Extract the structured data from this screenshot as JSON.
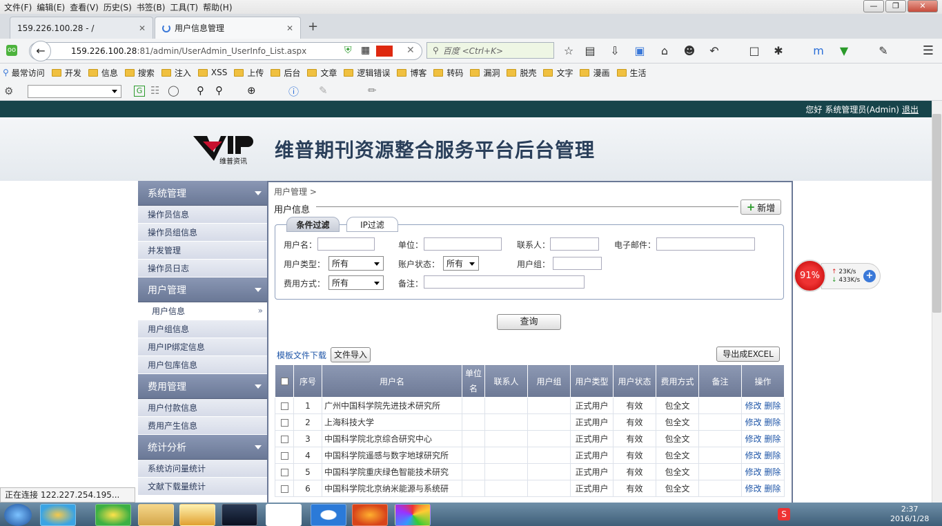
{
  "menubar": {
    "items": [
      "文件(F)",
      "编辑(E)",
      "查看(V)",
      "历史(S)",
      "书签(B)",
      "工具(T)",
      "帮助(H)"
    ]
  },
  "tabs": [
    {
      "label": "159.226.100.28 - /"
    },
    {
      "label": "用户信息管理"
    }
  ],
  "address": {
    "host": "159.226.100.28",
    "rest": ":81/admin/UserAdmin_UserInfo_List.aspx"
  },
  "search": {
    "placeholder": "百度 <Ctrl+K>"
  },
  "bookmarks": [
    "最常访问",
    "开发",
    "信息",
    "搜索",
    "注入",
    "XSS",
    "上传",
    "后台",
    "文章",
    "逻辑错误",
    "博客",
    "转码",
    "漏洞",
    "脱壳",
    "文字",
    "漫画",
    "生活"
  ],
  "header": {
    "greeting": "您好",
    "user": "系统管理员(Admin)",
    "logout": "退出"
  },
  "site": {
    "logo_text": "VIP",
    "logo_sub": "维普资讯",
    "title": "维普期刊资源整合服务平台后台管理"
  },
  "sidebar": {
    "sections": [
      {
        "title": "系统管理",
        "items": [
          "操作员信息",
          "操作员组信息",
          "并发管理",
          "操作员日志"
        ]
      },
      {
        "title": "用户管理",
        "items": [
          "用户信息",
          "用户组信息",
          "用户IP绑定信息",
          "用户包库信息"
        ]
      },
      {
        "title": "费用管理",
        "items": [
          "用户付款信息",
          "费用产生信息"
        ]
      },
      {
        "title": "统计分析",
        "items": [
          "系统访问量统计",
          "文献下载量统计"
        ]
      }
    ],
    "active_item": "用户信息"
  },
  "main": {
    "breadcrumb": "用户管理 >",
    "section_title": "用户信息",
    "add_label": "新增",
    "filter_tabs": [
      "条件过滤",
      "IP过滤"
    ],
    "filters": {
      "username": "用户名：",
      "unit": "单位：",
      "contact": "联系人：",
      "email": "电子邮件：",
      "user_type": "用户类型：",
      "user_type_value": "所有",
      "account_status": "账户状态：",
      "account_status_value": "所有",
      "user_group": "用户组：",
      "fee_mode": "费用方式：",
      "fee_mode_value": "所有",
      "remark": "备注："
    },
    "query_label": "查询",
    "template_link": "模板文件下载",
    "import_label": "文件导入",
    "export_label": "导出成EXCEL",
    "table": {
      "headers": [
        "序号",
        "用户名",
        "单位名",
        "联系人",
        "用户组",
        "用户类型",
        "用户状态",
        "费用方式",
        "备注",
        "操作"
      ],
      "edit_label": "修改",
      "delete_label": "删除",
      "rows": [
        {
          "no": "1",
          "name": "广州中国科学院先进技术研究所",
          "type": "正式用户",
          "status": "有效",
          "fee": "包全文"
        },
        {
          "no": "2",
          "name": "上海科技大学",
          "type": "正式用户",
          "status": "有效",
          "fee": "包全文"
        },
        {
          "no": "3",
          "name": "中国科学院北京综合研究中心",
          "type": "正式用户",
          "status": "有效",
          "fee": "包全文"
        },
        {
          "no": "4",
          "name": "中国科学院遥感与数字地球研究所",
          "type": "正式用户",
          "status": "有效",
          "fee": "包全文"
        },
        {
          "no": "5",
          "name": "中国科学院重庆绿色智能技术研究",
          "type": "正式用户",
          "status": "有效",
          "fee": "包全文"
        },
        {
          "no": "6",
          "name": "中国科学院北京纳米能源与系统研",
          "type": "正式用户",
          "status": "有效",
          "fee": "包全文"
        }
      ]
    }
  },
  "speed_widget": {
    "percent": "91%",
    "up": "23K/s",
    "down": "433K/s"
  },
  "statusbar": {
    "text": "正在连接 122.227.254.195..."
  },
  "taskbar": {
    "time": "2:37",
    "date": "2016/1/28"
  }
}
